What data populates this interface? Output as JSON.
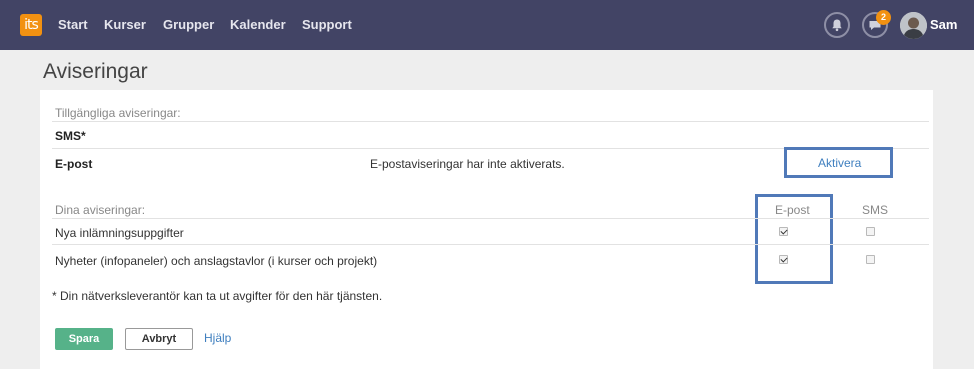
{
  "nav": {
    "logo_text": "its",
    "items": [
      {
        "label": "Start"
      },
      {
        "label": "Kurser"
      },
      {
        "label": "Grupper"
      },
      {
        "label": "Kalender"
      },
      {
        "label": "Support"
      }
    ],
    "notifications_icon": "bell-icon",
    "messages_icon": "chat-icon",
    "messages_badge": "2",
    "user_name": "Sam"
  },
  "page": {
    "title": "Aviseringar"
  },
  "available": {
    "heading": "Tillgängliga aviseringar:",
    "sms_label": "SMS*",
    "email_label": "E-post",
    "email_status": "E-postaviseringar har inte aktiverats.",
    "activate_link": "Aktivera"
  },
  "yours": {
    "heading": "Dina aviseringar:",
    "col_email": "E-post",
    "col_sms": "SMS",
    "rows": [
      {
        "label": "Nya inlämningsuppgifter",
        "email": true,
        "sms": false
      },
      {
        "label": "Nyheter (infopaneler) och anslagstavlor (i kurser och projekt)",
        "email": true,
        "sms": false
      }
    ],
    "footnote": "* Din nätverksleverantör kan ta ut avgifter för den här tjänsten."
  },
  "actions": {
    "save_label": "Spara",
    "cancel_label": "Avbryt",
    "help_label": "Hjälp"
  },
  "colors": {
    "topbar": "#424465",
    "accent": "#f29111",
    "primary_button": "#56b289",
    "highlight": "#5079b8",
    "link": "#3f7fbf"
  }
}
